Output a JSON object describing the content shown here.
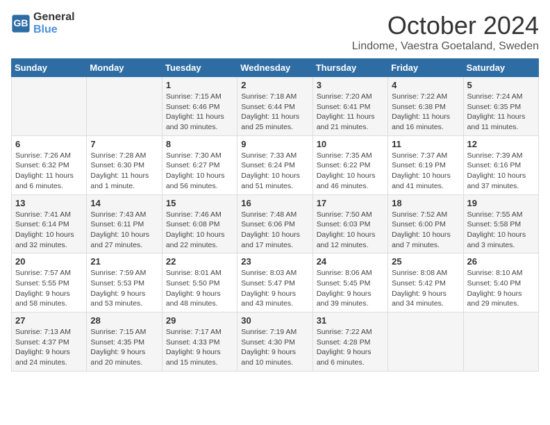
{
  "header": {
    "logo_line1": "General",
    "logo_line2": "Blue",
    "month_title": "October 2024",
    "subtitle": "Lindome, Vaestra Goetaland, Sweden"
  },
  "weekdays": [
    "Sunday",
    "Monday",
    "Tuesday",
    "Wednesday",
    "Thursday",
    "Friday",
    "Saturday"
  ],
  "weeks": [
    [
      {
        "day": "",
        "info": ""
      },
      {
        "day": "",
        "info": ""
      },
      {
        "day": "1",
        "info": "Sunrise: 7:15 AM\nSunset: 6:46 PM\nDaylight: 11 hours\nand 30 minutes."
      },
      {
        "day": "2",
        "info": "Sunrise: 7:18 AM\nSunset: 6:44 PM\nDaylight: 11 hours\nand 25 minutes."
      },
      {
        "day": "3",
        "info": "Sunrise: 7:20 AM\nSunset: 6:41 PM\nDaylight: 11 hours\nand 21 minutes."
      },
      {
        "day": "4",
        "info": "Sunrise: 7:22 AM\nSunset: 6:38 PM\nDaylight: 11 hours\nand 16 minutes."
      },
      {
        "day": "5",
        "info": "Sunrise: 7:24 AM\nSunset: 6:35 PM\nDaylight: 11 hours\nand 11 minutes."
      }
    ],
    [
      {
        "day": "6",
        "info": "Sunrise: 7:26 AM\nSunset: 6:32 PM\nDaylight: 11 hours\nand 6 minutes."
      },
      {
        "day": "7",
        "info": "Sunrise: 7:28 AM\nSunset: 6:30 PM\nDaylight: 11 hours\nand 1 minute."
      },
      {
        "day": "8",
        "info": "Sunrise: 7:30 AM\nSunset: 6:27 PM\nDaylight: 10 hours\nand 56 minutes."
      },
      {
        "day": "9",
        "info": "Sunrise: 7:33 AM\nSunset: 6:24 PM\nDaylight: 10 hours\nand 51 minutes."
      },
      {
        "day": "10",
        "info": "Sunrise: 7:35 AM\nSunset: 6:22 PM\nDaylight: 10 hours\nand 46 minutes."
      },
      {
        "day": "11",
        "info": "Sunrise: 7:37 AM\nSunset: 6:19 PM\nDaylight: 10 hours\nand 41 minutes."
      },
      {
        "day": "12",
        "info": "Sunrise: 7:39 AM\nSunset: 6:16 PM\nDaylight: 10 hours\nand 37 minutes."
      }
    ],
    [
      {
        "day": "13",
        "info": "Sunrise: 7:41 AM\nSunset: 6:14 PM\nDaylight: 10 hours\nand 32 minutes."
      },
      {
        "day": "14",
        "info": "Sunrise: 7:43 AM\nSunset: 6:11 PM\nDaylight: 10 hours\nand 27 minutes."
      },
      {
        "day": "15",
        "info": "Sunrise: 7:46 AM\nSunset: 6:08 PM\nDaylight: 10 hours\nand 22 minutes."
      },
      {
        "day": "16",
        "info": "Sunrise: 7:48 AM\nSunset: 6:06 PM\nDaylight: 10 hours\nand 17 minutes."
      },
      {
        "day": "17",
        "info": "Sunrise: 7:50 AM\nSunset: 6:03 PM\nDaylight: 10 hours\nand 12 minutes."
      },
      {
        "day": "18",
        "info": "Sunrise: 7:52 AM\nSunset: 6:00 PM\nDaylight: 10 hours\nand 7 minutes."
      },
      {
        "day": "19",
        "info": "Sunrise: 7:55 AM\nSunset: 5:58 PM\nDaylight: 10 hours\nand 3 minutes."
      }
    ],
    [
      {
        "day": "20",
        "info": "Sunrise: 7:57 AM\nSunset: 5:55 PM\nDaylight: 9 hours\nand 58 minutes."
      },
      {
        "day": "21",
        "info": "Sunrise: 7:59 AM\nSunset: 5:53 PM\nDaylight: 9 hours\nand 53 minutes."
      },
      {
        "day": "22",
        "info": "Sunrise: 8:01 AM\nSunset: 5:50 PM\nDaylight: 9 hours\nand 48 minutes."
      },
      {
        "day": "23",
        "info": "Sunrise: 8:03 AM\nSunset: 5:47 PM\nDaylight: 9 hours\nand 43 minutes."
      },
      {
        "day": "24",
        "info": "Sunrise: 8:06 AM\nSunset: 5:45 PM\nDaylight: 9 hours\nand 39 minutes."
      },
      {
        "day": "25",
        "info": "Sunrise: 8:08 AM\nSunset: 5:42 PM\nDaylight: 9 hours\nand 34 minutes."
      },
      {
        "day": "26",
        "info": "Sunrise: 8:10 AM\nSunset: 5:40 PM\nDaylight: 9 hours\nand 29 minutes."
      }
    ],
    [
      {
        "day": "27",
        "info": "Sunrise: 7:13 AM\nSunset: 4:37 PM\nDaylight: 9 hours\nand 24 minutes."
      },
      {
        "day": "28",
        "info": "Sunrise: 7:15 AM\nSunset: 4:35 PM\nDaylight: 9 hours\nand 20 minutes."
      },
      {
        "day": "29",
        "info": "Sunrise: 7:17 AM\nSunset: 4:33 PM\nDaylight: 9 hours\nand 15 minutes."
      },
      {
        "day": "30",
        "info": "Sunrise: 7:19 AM\nSunset: 4:30 PM\nDaylight: 9 hours\nand 10 minutes."
      },
      {
        "day": "31",
        "info": "Sunrise: 7:22 AM\nSunset: 4:28 PM\nDaylight: 9 hours\nand 6 minutes."
      },
      {
        "day": "",
        "info": ""
      },
      {
        "day": "",
        "info": ""
      }
    ]
  ]
}
